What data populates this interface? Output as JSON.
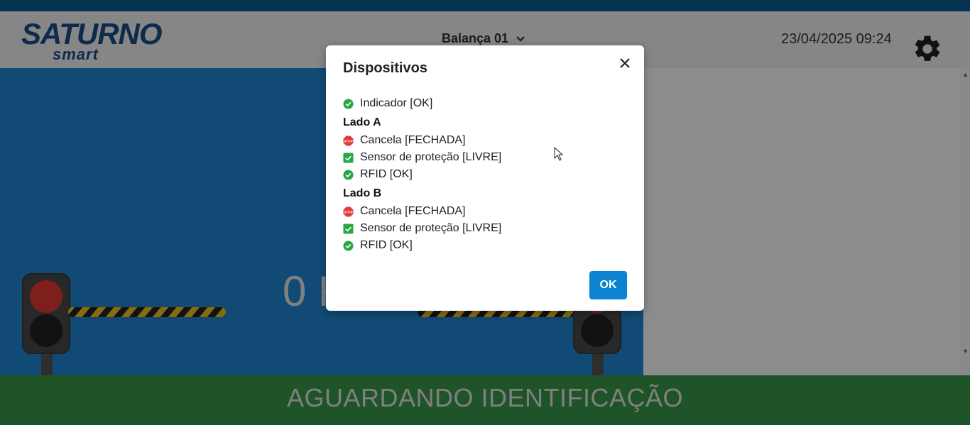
{
  "header": {
    "logo_main": "SATURNO",
    "logo_sub": "smart",
    "scale_selector": "Balança 01",
    "datetime": "23/04/2025 09:24"
  },
  "main": {
    "weight": "0 K"
  },
  "footer": {
    "status": "AGUARDANDO IDENTIFICAÇÃO"
  },
  "dialog": {
    "title": "Dispositivos",
    "indicator": "Indicador [OK]",
    "side_a": {
      "label": "Lado A",
      "items": [
        "Cancela [FECHADA]",
        "Sensor de proteção [LIVRE]",
        "RFID [OK]"
      ]
    },
    "side_b": {
      "label": "Lado B",
      "items": [
        "Cancela [FECHADA]",
        "Sensor de proteção [LIVRE]",
        "RFID [OK]"
      ]
    },
    "ok_label": "OK"
  },
  "icons": {
    "ok": "check-circle-icon",
    "stop": "stop-sign-icon",
    "sensor": "check-square-icon"
  },
  "colors": {
    "top_bar": "#0d5a93",
    "main_blue": "#1f88d6",
    "footer_green": "#3a9a4a",
    "ok_button": "#0a84d0",
    "check_green": "#28a745",
    "stop_red": "#e53935"
  }
}
